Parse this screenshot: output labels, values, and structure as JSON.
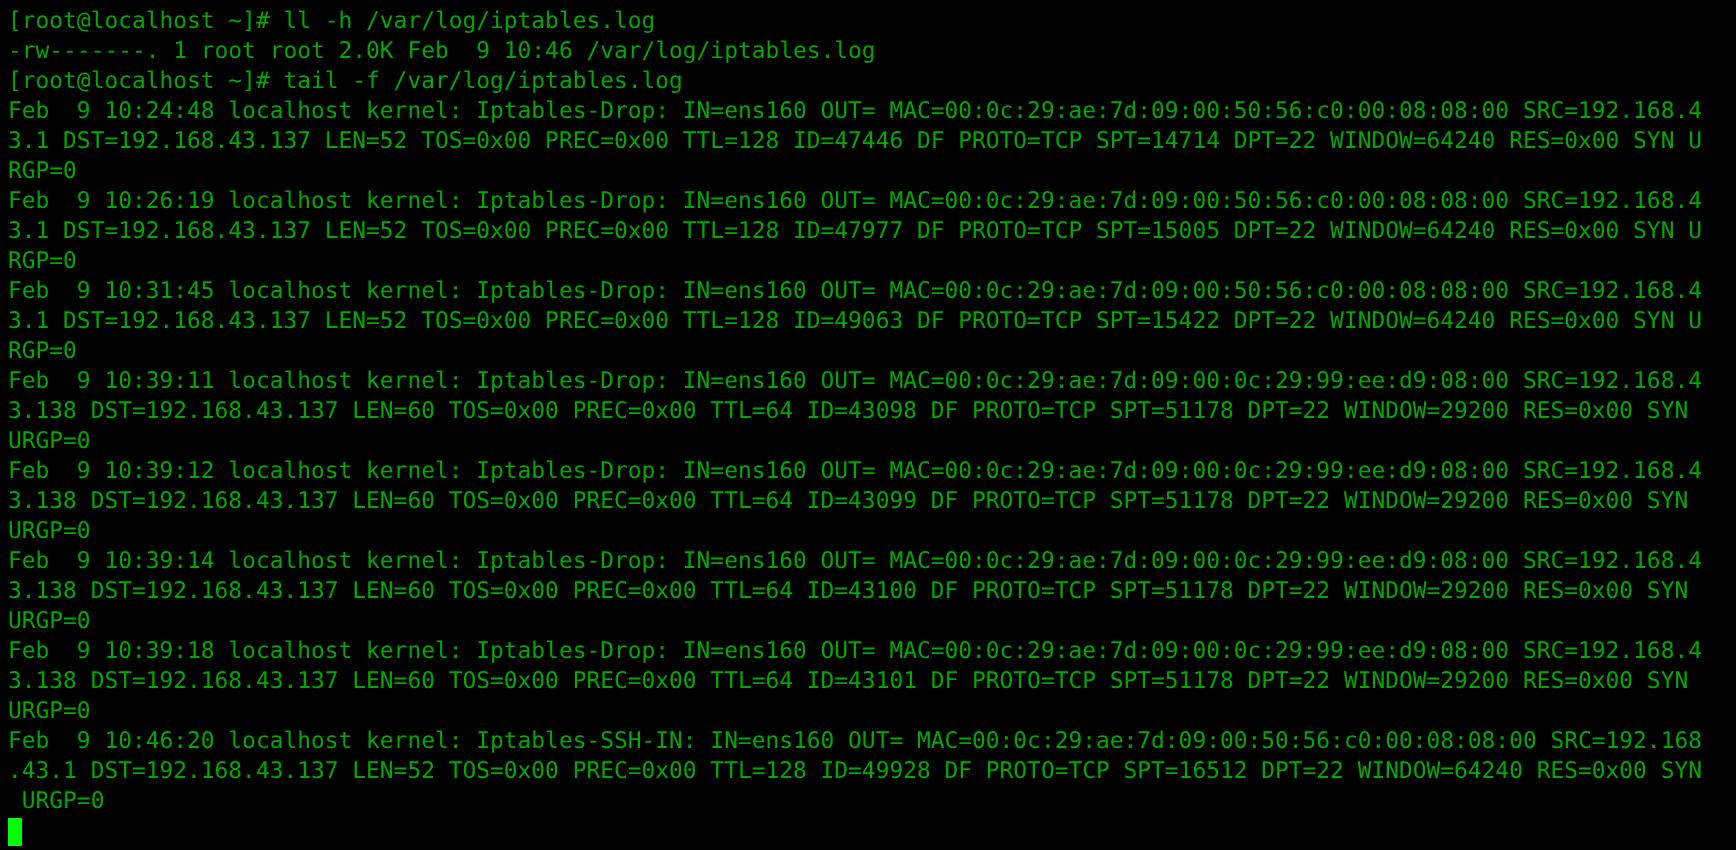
{
  "terminal": {
    "lines": [
      "[root@localhost ~]# ll -h /var/log/iptables.log",
      "-rw-------. 1 root root 2.0K Feb  9 10:46 /var/log/iptables.log",
      "[root@localhost ~]# tail -f /var/log/iptables.log",
      "Feb  9 10:24:48 localhost kernel: Iptables-Drop: IN=ens160 OUT= MAC=00:0c:29:ae:7d:09:00:50:56:c0:00:08:08:00 SRC=192.168.4",
      "3.1 DST=192.168.43.137 LEN=52 TOS=0x00 PREC=0x00 TTL=128 ID=47446 DF PROTO=TCP SPT=14714 DPT=22 WINDOW=64240 RES=0x00 SYN U",
      "RGP=0",
      "Feb  9 10:26:19 localhost kernel: Iptables-Drop: IN=ens160 OUT= MAC=00:0c:29:ae:7d:09:00:50:56:c0:00:08:08:00 SRC=192.168.4",
      "3.1 DST=192.168.43.137 LEN=52 TOS=0x00 PREC=0x00 TTL=128 ID=47977 DF PROTO=TCP SPT=15005 DPT=22 WINDOW=64240 RES=0x00 SYN U",
      "RGP=0",
      "Feb  9 10:31:45 localhost kernel: Iptables-Drop: IN=ens160 OUT= MAC=00:0c:29:ae:7d:09:00:50:56:c0:00:08:08:00 SRC=192.168.4",
      "3.1 DST=192.168.43.137 LEN=52 TOS=0x00 PREC=0x00 TTL=128 ID=49063 DF PROTO=TCP SPT=15422 DPT=22 WINDOW=64240 RES=0x00 SYN U",
      "RGP=0",
      "Feb  9 10:39:11 localhost kernel: Iptables-Drop: IN=ens160 OUT= MAC=00:0c:29:ae:7d:09:00:0c:29:99:ee:d9:08:00 SRC=192.168.4",
      "3.138 DST=192.168.43.137 LEN=60 TOS=0x00 PREC=0x00 TTL=64 ID=43098 DF PROTO=TCP SPT=51178 DPT=22 WINDOW=29200 RES=0x00 SYN",
      "URGP=0",
      "Feb  9 10:39:12 localhost kernel: Iptables-Drop: IN=ens160 OUT= MAC=00:0c:29:ae:7d:09:00:0c:29:99:ee:d9:08:00 SRC=192.168.4",
      "3.138 DST=192.168.43.137 LEN=60 TOS=0x00 PREC=0x00 TTL=64 ID=43099 DF PROTO=TCP SPT=51178 DPT=22 WINDOW=29200 RES=0x00 SYN",
      "URGP=0",
      "Feb  9 10:39:14 localhost kernel: Iptables-Drop: IN=ens160 OUT= MAC=00:0c:29:ae:7d:09:00:0c:29:99:ee:d9:08:00 SRC=192.168.4",
      "3.138 DST=192.168.43.137 LEN=60 TOS=0x00 PREC=0x00 TTL=64 ID=43100 DF PROTO=TCP SPT=51178 DPT=22 WINDOW=29200 RES=0x00 SYN",
      "URGP=0",
      "Feb  9 10:39:18 localhost kernel: Iptables-Drop: IN=ens160 OUT= MAC=00:0c:29:ae:7d:09:00:0c:29:99:ee:d9:08:00 SRC=192.168.4",
      "3.138 DST=192.168.43.137 LEN=60 TOS=0x00 PREC=0x00 TTL=64 ID=43101 DF PROTO=TCP SPT=51178 DPT=22 WINDOW=29200 RES=0x00 SYN",
      "URGP=0",
      "Feb  9 10:46:20 localhost kernel: Iptables-SSH-IN: IN=ens160 OUT= MAC=00:0c:29:ae:7d:09:00:50:56:c0:00:08:08:00 SRC=192.168",
      ".43.1 DST=192.168.43.137 LEN=52 TOS=0x00 PREC=0x00 TTL=128 ID=49928 DF PROTO=TCP SPT=16512 DPT=22 WINDOW=64240 RES=0x00 SYN",
      " URGP=0"
    ]
  }
}
